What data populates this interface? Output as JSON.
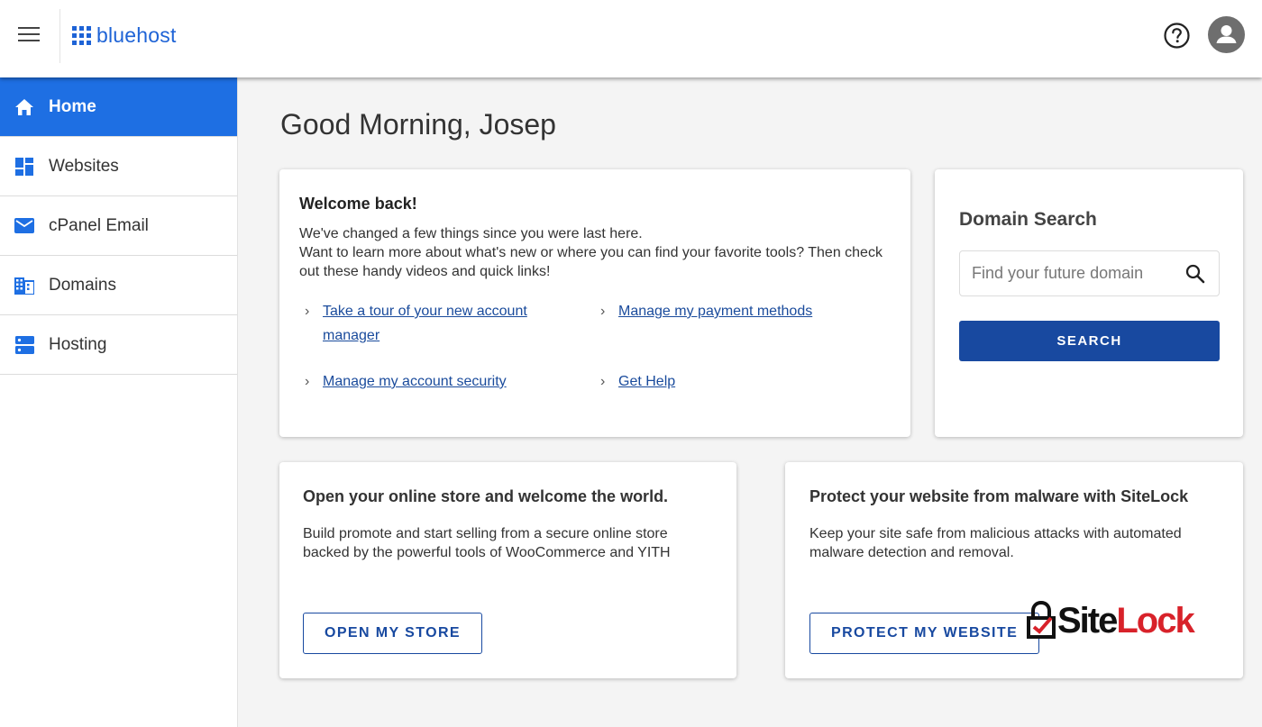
{
  "header": {
    "logo_text": "bluehost"
  },
  "sidebar": {
    "items": [
      {
        "label": "Home",
        "icon": "home-icon",
        "active": true
      },
      {
        "label": "Websites",
        "icon": "dashboard-icon",
        "active": false
      },
      {
        "label": "cPanel Email",
        "icon": "mail-icon",
        "active": false
      },
      {
        "label": "Domains",
        "icon": "domains-icon",
        "active": false
      },
      {
        "label": "Hosting",
        "icon": "server-icon",
        "active": false
      }
    ]
  },
  "main": {
    "greeting": "Good Morning, Josep",
    "welcome": {
      "title": "Welcome back!",
      "line1": "We've changed a few things since you were last here.",
      "line2": "Want to learn more about what's new or where you can find your favorite tools? Then check out these handy videos and quick links!",
      "links": {
        "tour": "Take a tour of your new account manager",
        "payment": "Manage my payment methods",
        "security": "Manage my account security",
        "help": "Get Help"
      }
    },
    "domain_search": {
      "title": "Domain Search",
      "placeholder": "Find your future domain",
      "value": "",
      "button": "SEARCH"
    },
    "store_card": {
      "title": "Open your online store and welcome the world.",
      "text": "Build promote and start selling from a secure online store backed by the powerful tools of WooCommerce and YITH",
      "button": "OPEN MY STORE"
    },
    "sitelock_card": {
      "title": "Protect your website from malware with SiteLock",
      "text": "Keep your site safe from malicious attacks with automated malware detection and removal.",
      "button": "PROTECT MY WEBSITE",
      "logo_site": "Site",
      "logo_lock": "Lock"
    }
  },
  "colors": {
    "brand_blue": "#1e6fe3",
    "button_blue": "#1849a0",
    "link_blue": "#1a4b9c",
    "sitelock_red": "#d8222a"
  }
}
